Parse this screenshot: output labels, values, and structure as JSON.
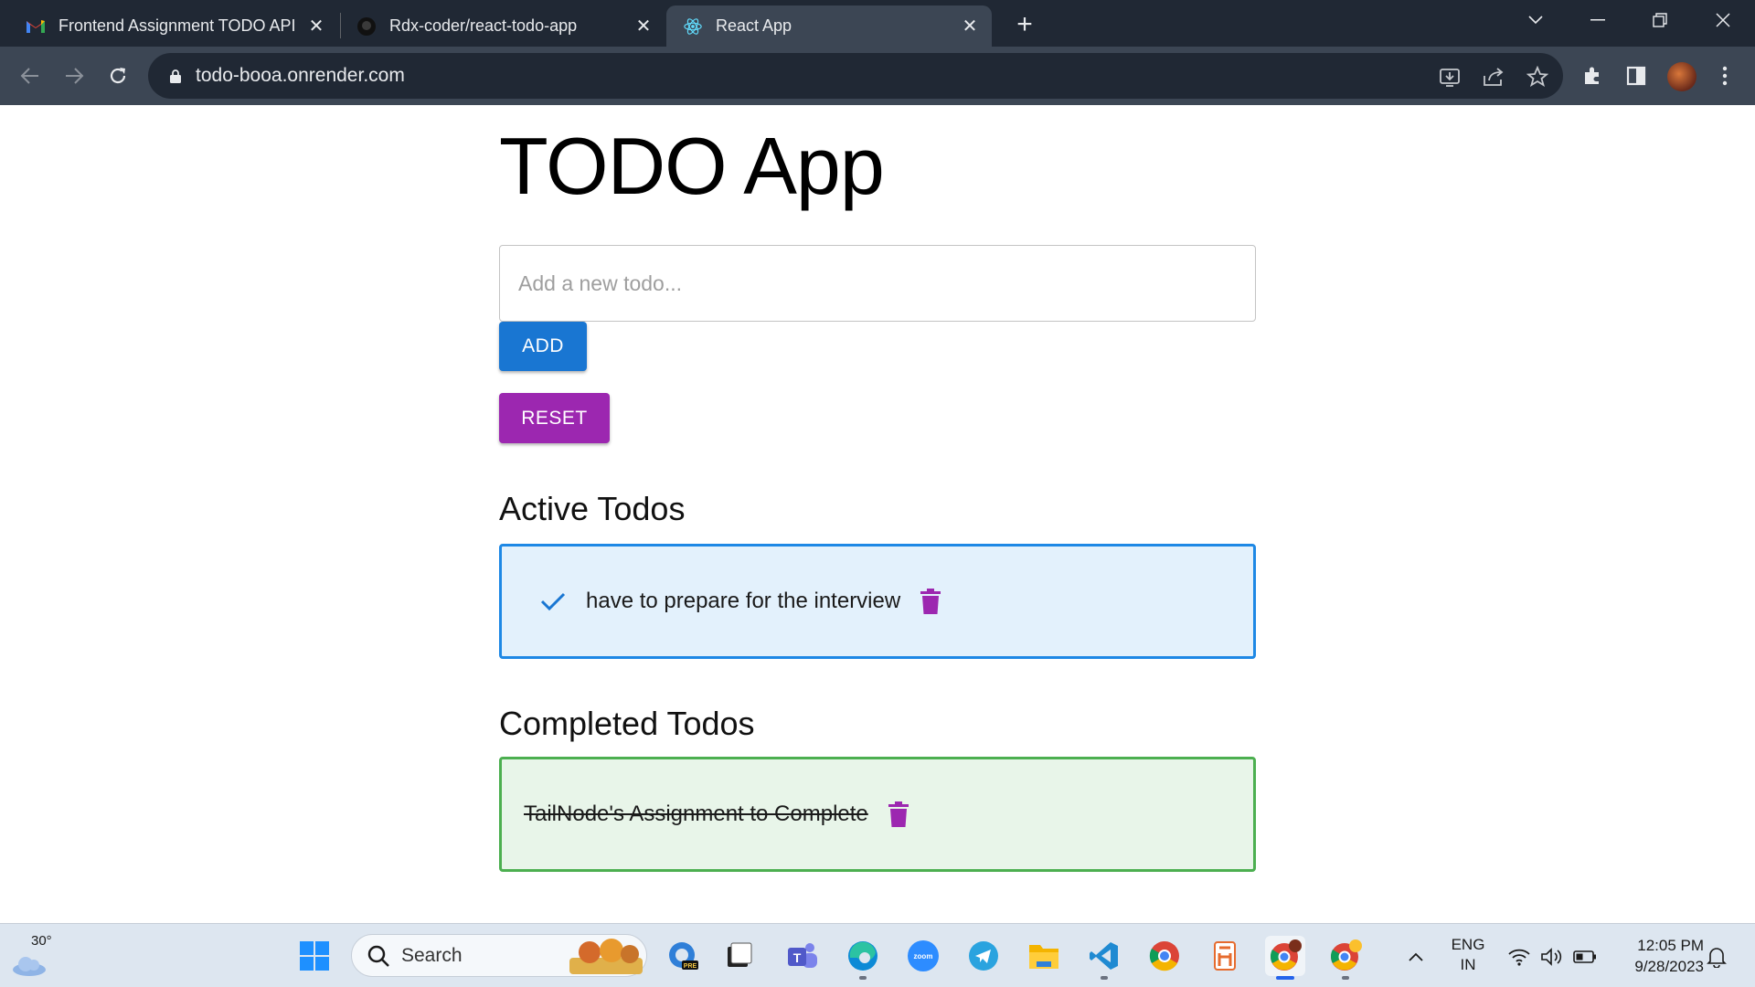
{
  "browser": {
    "tabs": [
      {
        "title": "Frontend Assignment TODO API",
        "icon": "gmail-icon"
      },
      {
        "title": "Rdx-coder/react-todo-app",
        "icon": "github-icon"
      },
      {
        "title": "React App",
        "icon": "react-icon",
        "active": true
      }
    ],
    "url": "todo-booa.onrender.com"
  },
  "app": {
    "title": "TODO App",
    "input_placeholder": "Add a new todo...",
    "input_value": "",
    "add_label": "ADD",
    "reset_label": "RESET",
    "active_heading": "Active Todos",
    "completed_heading": "Completed Todos",
    "active_todos": [
      {
        "text": "have to prepare for the interview"
      }
    ],
    "completed_todos": [
      {
        "text": "TailNode's Assignment to Complete"
      }
    ],
    "colors": {
      "primary": "#1976d2",
      "secondary": "#9c27b0",
      "active_card_bg": "#e3f1fc",
      "active_card_border": "#1e88e5",
      "completed_card_bg": "#e8f5e9",
      "completed_card_border": "#4caf50"
    }
  },
  "taskbar": {
    "weather_temp": "30°",
    "search_label": "Search",
    "language_line1": "ENG",
    "language_line2": "IN",
    "time": "12:05 PM",
    "date": "9/28/2023",
    "apps": [
      "start-icon",
      "search-icon",
      "edge-preview-icon",
      "task-view-icon",
      "teams-icon",
      "edge-icon",
      "zoom-icon",
      "telegram-icon",
      "file-explorer-icon",
      "vscode-icon",
      "chrome-icon",
      "app-icon",
      "chrome-profile-icon",
      "chrome-canary-icon"
    ]
  }
}
